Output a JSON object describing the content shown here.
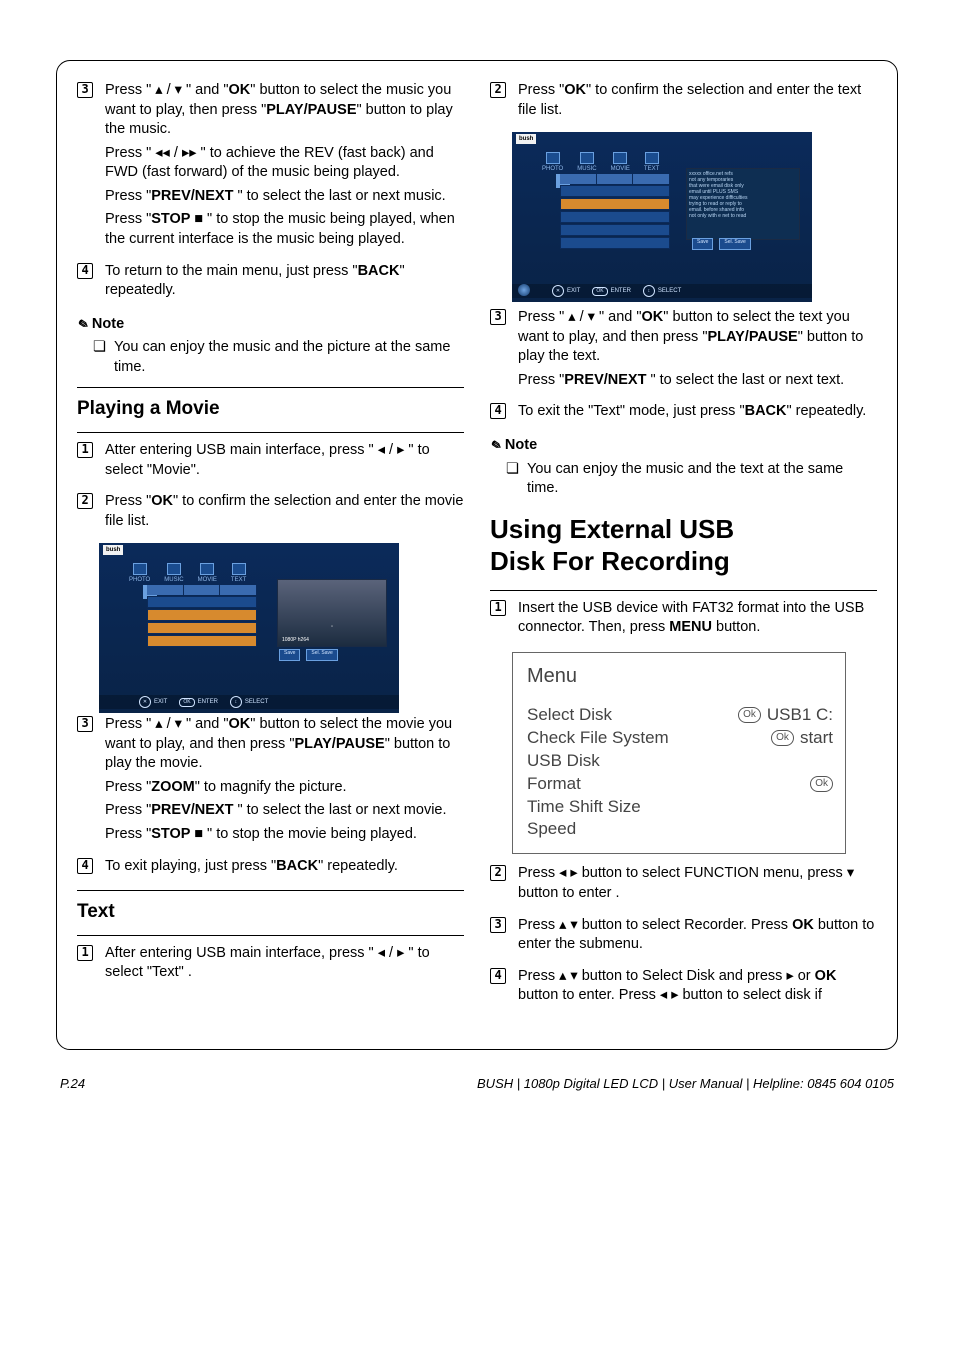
{
  "glyphs": {
    "up": "▴",
    "down": "▾",
    "left": "◂",
    "right": "▸",
    "rew": "◂◂",
    "fwd": "▸▸",
    "stop": "■",
    "pencil": "✎",
    "note_bullet": "❏"
  },
  "left": {
    "step3": {
      "p1a": "Press \" ",
      "p1b": " / ",
      "p1c": " \" and \"",
      "p1_ok": "OK",
      "p1d": "\" button to select the music you want to play, then press \"",
      "p1_play": "PLAY/PAUSE",
      "p1e": "\" button to play the music.",
      "p2a": "Press \" ",
      "p2b": " / ",
      "p2c": " \" to achieve the REV (fast back) and FWD (fast forward) of the music being played.",
      "p3a": "Press \"",
      "p3_prev": "PREV/NEXT",
      "p3b": " \" to select the last or next music.",
      "p4a": "Press \"",
      "p4_stop": "STOP ",
      "p4b": " \" to stop the music being played, when the current interface is the music being played."
    },
    "step4": {
      "a": "To return to the main menu, just press \"",
      "back": "BACK",
      "b": "\" repeatedly."
    },
    "note_label": "Note",
    "note_text": "You can enjoy the music and the picture at the same time.",
    "movie_title": "Playing a Movie",
    "movie1a": "Atter entering USB main interface, press \" ",
    "movie1b": " / ",
    "movie1c": " \" to select \"Movie\".",
    "movie2a": "Press \"",
    "movie2_ok": "OK",
    "movie2b": "\" to confirm the selection and enter the movie file list.",
    "movie3": {
      "p1a": "Press \" ",
      "p1b": " / ",
      "p1c": " \" and \"",
      "p1_ok": "OK",
      "p1d": "\" button to select the movie you want to play, and then press \"",
      "p1_play": "PLAY/PAUSE",
      "p1e": "\" button to play the movie.",
      "p2a": "Press \"",
      "p2_zoom": "ZOOM",
      "p2b": "\" to magnify the picture.",
      "p3a": "Press \"",
      "p3_prev": "PREV/NEXT",
      "p3b": " \" to select the last or next movie.",
      "p4a": "Press \"",
      "p4_stop": "STOP ",
      "p4b": " \" to stop the movie being played."
    },
    "movie4a": "To exit playing, just press \"",
    "movie4_back": "BACK",
    "movie4b": "\" repeatedly.",
    "text_title": "Text",
    "text1a": "After entering USB main interface, press \" ",
    "text1b": " / ",
    "text1c": " \" to select \"Text\" ."
  },
  "right": {
    "step2a": "Press \"",
    "step2_ok": "OK",
    "step2b": "\" to confirm the selection and enter the text file list.",
    "step3": {
      "p1a": "Press \" ",
      "p1b": " / ",
      "p1c": " \" and \"",
      "p1_ok": "OK",
      "p1d": "\" button to select the text you want to play, and then press \"",
      "p1_play": "PLAY/PAUSE",
      "p1e": "\" button to play the text.",
      "p2a": "Press \"",
      "p2_prev": "PREV/NEXT",
      "p2b": " \" to select the last or next text."
    },
    "step4a": "To exit the \"Text\" mode, just press \"",
    "step4_back": "BACK",
    "step4b": "\" repeatedly.",
    "note_label": "Note",
    "note_text": "You can enjoy the music and the text at the same time.",
    "big_heading_l1": "Using External USB",
    "big_heading_l2": "Disk For Recording",
    "rec1a": "Insert the USB device with FAT32 format into the USB connector. Then, press ",
    "rec1_menu": "MENU",
    "rec1b": " button.",
    "menu": {
      "title": "Menu",
      "r1l": "Select  Disk",
      "r1r": "USB1 C:",
      "r2l": "Check File System",
      "r2r": "start",
      "r3l": "USB Disk",
      "r4l": "Format",
      "r5l": "Time Shift Size",
      "r6l": "Speed",
      "ok": "Ok"
    },
    "rec2a": "Press ",
    "rec2b": " button to select FUNCTION menu, press ",
    "rec2c": " button to enter .",
    "rec3a": "Press ",
    "rec3b": " button to select Recorder. Press ",
    "rec3_ok": "OK",
    "rec3c": " button to enter the submenu.",
    "rec4a": "Press ",
    "rec4b": " button to Select Disk and press ",
    "rec4c": " or ",
    "rec4_ok": "OK",
    "rec4d": " button to enter. Press ",
    "rec4e": " button to select disk if"
  },
  "shots": {
    "logo": "bush",
    "icons": [
      "PHOTO",
      "MUSIC",
      "MOVIE",
      "TEXT"
    ],
    "movie_caption": "1080P h264",
    "text_preview": "xxxxx office.net refs\nnot any temporaries\nthat were email disk only\nemail until PLUS SMS\nmay experience difficulties\ntrying to read or reply to\nemail. before shared info\nnot only with e net to read",
    "save_a": "Save",
    "save_b": "Sel. Save",
    "bot_exit": "EXIT",
    "bot_enter": "ENTER",
    "bot_select": "SELECT",
    "bot_ok": "OK"
  },
  "footer": {
    "left": "P.24",
    "right": "BUSH  | 1080p  Digital LED LCD | User Manual | Helpline: 0845 604 0105"
  }
}
